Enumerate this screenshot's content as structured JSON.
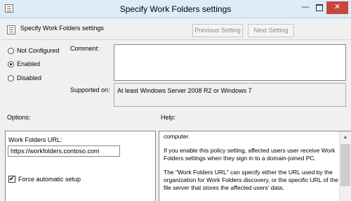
{
  "window": {
    "title": "Specify Work Folders settings",
    "buttons": {
      "minimize": "—",
      "maximize": "",
      "close": "✕"
    }
  },
  "header": {
    "setting_name": "Specify Work Folders settings",
    "previous_label": "Previous Setting",
    "next_label": "Next Setting"
  },
  "state": {
    "options": [
      {
        "label": "Not Configured",
        "selected": false
      },
      {
        "label": "Enabled",
        "selected": true
      },
      {
        "label": "Disabled",
        "selected": false
      }
    ]
  },
  "comment": {
    "label": "Comment:",
    "value": ""
  },
  "supported": {
    "label": "Supported on:",
    "value": "At least Windows Server 2008 R2 or Windows 7"
  },
  "options_pane": {
    "heading": "Options:",
    "url_label": "Work Folders URL:",
    "url_value": "https://workfolders.contoso.com",
    "force_label": "Force automatic setup",
    "force_checked": true
  },
  "help_pane": {
    "heading": "Help:",
    "paragraphs": [
      "computer.",
      "If you enable this policy setting, affected users user receive Work Folders settings when they sign in to a domain-joined PC.",
      "The \"Work Folders URL\" can specify either the URL used by the organization for Work Folders discovery, or the specific URL of the file server that stores the affected users' data."
    ]
  }
}
